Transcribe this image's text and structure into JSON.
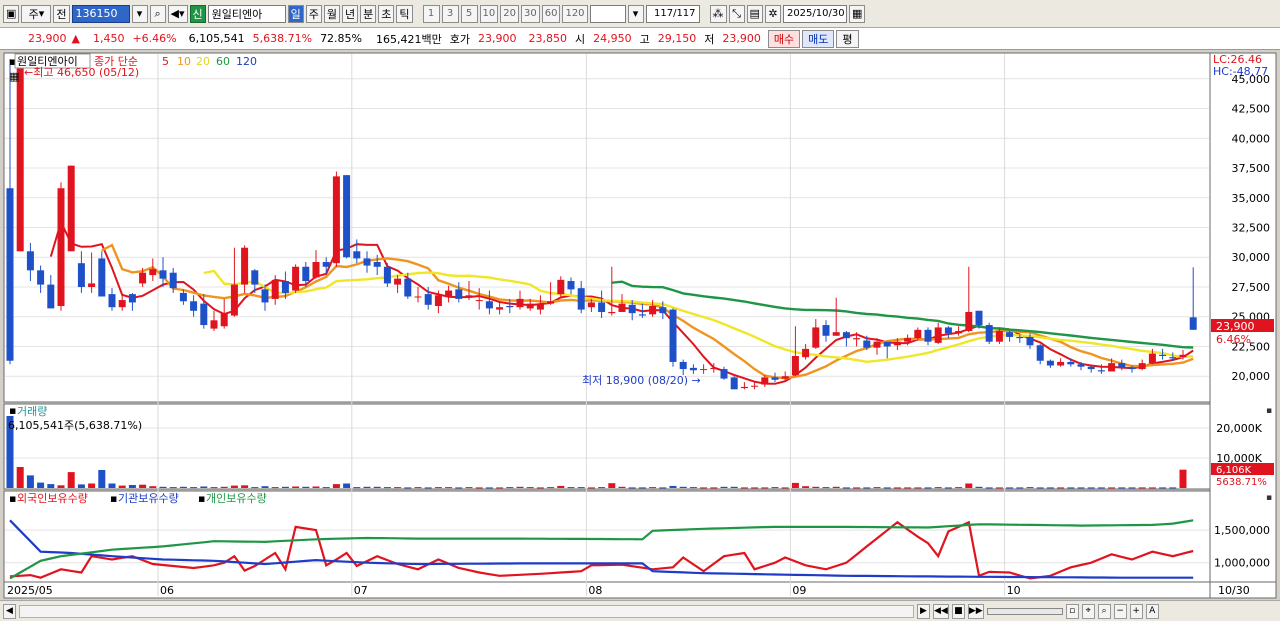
{
  "toolbar": {
    "period_week": "주",
    "prev_label": "전",
    "code": "136150",
    "market_badge": "신",
    "stock_name": "원일티엔아",
    "periods": [
      "일",
      "주",
      "월",
      "년",
      "분",
      "초",
      "틱"
    ],
    "active_period": "일",
    "intervals": [
      "1",
      "3",
      "5",
      "10",
      "20",
      "30",
      "60",
      "120"
    ],
    "counter": "117",
    "counter_total": "/117",
    "date": "2025/10/30"
  },
  "quote": {
    "price": "23,900",
    "change_arrow": "▲",
    "change": "1,450",
    "change_pct": "+6.46%",
    "volume": "6,105,541",
    "volume_pct": "5,638.71%",
    "turnover": "72.85%",
    "amount": "165,421백만",
    "hoga_label": "호가",
    "ask": "23,900",
    "bid": "23,850",
    "open_label": "시",
    "open": "24,950",
    "high_label": "고",
    "high": "29,150",
    "low_label": "저",
    "low": "23,900",
    "buy_label": "매수",
    "sell_label": "매도",
    "avg_label": "평"
  },
  "price_panel": {
    "name": "원일티엔아이",
    "legend_title": "종가 단순",
    "ma_labels": [
      "5",
      "10",
      "20",
      "60",
      "120"
    ],
    "ma_colors": [
      "#e0141e",
      "#f09420",
      "#f0e628",
      "#1e9646",
      "#1e3cc8"
    ],
    "max_label": "최고 46,650 (05/12)",
    "min_label": "최저 18,900 (08/20)",
    "lc_label": "LC:26.46",
    "hc_label": "HC:-48.77",
    "current_tag": "23,900",
    "current_pct_tag": "6.46%"
  },
  "volume_panel": {
    "title": "거래량",
    "info": "6,105,541주(5,638.71%)",
    "current_tag": "6,106K",
    "current_pct_tag": "5638.71%"
  },
  "holdings_panel": {
    "series_labels": [
      "외국인보유수량",
      "기관보유수량",
      "개인보유수량"
    ],
    "series_colors": [
      "#e0141e",
      "#1e3cc8",
      "#1e9646"
    ]
  },
  "chart_data": {
    "type": "candlestick",
    "price_axis": {
      "ticks": [
        20000,
        22500,
        25000,
        27500,
        30000,
        32500,
        35000,
        37500,
        40000,
        42500,
        45000
      ],
      "labels": [
        "20,000",
        "22,500",
        "25,000",
        "27,500",
        "30,000",
        "32,500",
        "35,000",
        "37,500",
        "40,000",
        "42,500",
        "45,000"
      ],
      "range": [
        18000,
        47000
      ]
    },
    "volume_axis": {
      "labels": [
        "10,000K",
        "20,000K"
      ],
      "ticks": [
        10000,
        20000
      ],
      "range": [
        0,
        27000
      ]
    },
    "holdings_axis": {
      "labels": [
        "1,000,000",
        "1,500,000"
      ],
      "ticks": [
        1000000,
        1500000
      ],
      "range": [
        720000,
        1870000
      ]
    },
    "date_labels": [
      "2025/05",
      "06",
      "07",
      "08",
      "09",
      "10",
      "10/30"
    ],
    "date_label_index": [
      0,
      15,
      34,
      57,
      77,
      98,
      116
    ],
    "candles": [
      [
        35800,
        21300,
        46650,
        21000
      ],
      [
        30500,
        46650,
        46650,
        30500
      ],
      [
        30500,
        28900,
        31200,
        28000
      ],
      [
        28900,
        27700,
        29300,
        27000
      ],
      [
        27700,
        25700,
        28500,
        25700
      ],
      [
        25900,
        35800,
        36300,
        25500
      ],
      [
        30500,
        37700,
        37700,
        30500
      ],
      [
        29500,
        27500,
        30500,
        27000
      ],
      [
        27500,
        27800,
        30400,
        27000
      ],
      [
        29900,
        26700,
        30500,
        26700
      ],
      [
        26900,
        25800,
        27400,
        25500
      ],
      [
        25800,
        26400,
        26900,
        25500
      ],
      [
        26900,
        26200,
        27000,
        25500
      ],
      [
        27800,
        28700,
        29100,
        27500
      ],
      [
        28500,
        29000,
        29900,
        28000
      ],
      [
        28900,
        28200,
        30000,
        27500
      ],
      [
        28700,
        27400,
        29100,
        27000
      ],
      [
        27000,
        26300,
        27300,
        26000
      ],
      [
        26300,
        25500,
        26800,
        25000
      ],
      [
        26100,
        24300,
        26900,
        24000
      ],
      [
        24000,
        24700,
        25500,
        23800
      ],
      [
        24200,
        25300,
        26500,
        24000
      ],
      [
        25100,
        27700,
        30800,
        25000
      ],
      [
        27700,
        30800,
        31000,
        27000
      ],
      [
        28900,
        27700,
        29000,
        27000
      ],
      [
        27300,
        26200,
        27700,
        25500
      ],
      [
        26500,
        28100,
        28500,
        26000
      ],
      [
        28000,
        27000,
        28800,
        26500
      ],
      [
        27200,
        29200,
        29400,
        27000
      ],
      [
        29200,
        28000,
        29600,
        27500
      ],
      [
        28300,
        29600,
        30600,
        28200
      ],
      [
        29600,
        29200,
        30000,
        28600
      ],
      [
        29500,
        36800,
        37200,
        29200
      ],
      [
        36900,
        30000,
        36900,
        29900
      ],
      [
        30500,
        29900,
        31500,
        29500
      ],
      [
        29900,
        29300,
        30500,
        28700
      ],
      [
        29600,
        29200,
        30200,
        28500
      ],
      [
        29200,
        27800,
        29500,
        27500
      ],
      [
        27700,
        28200,
        28500,
        27000
      ],
      [
        28200,
        26700,
        28700,
        26500
      ],
      [
        26700,
        26700,
        27500,
        26200
      ],
      [
        26900,
        26000,
        27500,
        25600
      ],
      [
        25900,
        26800,
        27200,
        25300
      ],
      [
        26700,
        27200,
        27600,
        26200
      ],
      [
        27300,
        26500,
        27900,
        26200
      ],
      [
        26600,
        26800,
        28000,
        26400
      ],
      [
        26400,
        26400,
        27400,
        25600
      ],
      [
        26300,
        25700,
        27200,
        25200
      ],
      [
        25600,
        25800,
        26300,
        25200
      ],
      [
        25900,
        25800,
        26500,
        25300
      ],
      [
        25800,
        26500,
        27200,
        25600
      ],
      [
        25700,
        26100,
        26500,
        25500
      ],
      [
        25600,
        26100,
        26800,
        25200
      ],
      [
        26100,
        26300,
        27900,
        26000
      ],
      [
        26900,
        28100,
        28400,
        26600
      ],
      [
        28000,
        27300,
        28300,
        26900
      ],
      [
        27400,
        25600,
        28000,
        25300
      ],
      [
        25800,
        26200,
        26500,
        25400
      ],
      [
        26200,
        25400,
        27200,
        24900
      ],
      [
        25300,
        25400,
        29200,
        25100
      ],
      [
        25400,
        26100,
        26900,
        25400
      ],
      [
        26000,
        25300,
        26400,
        24700
      ],
      [
        25200,
        25100,
        26100,
        24900
      ],
      [
        25200,
        25900,
        26400,
        25000
      ],
      [
        25800,
        25300,
        26300,
        24800
      ],
      [
        25600,
        21200,
        25700,
        20800
      ],
      [
        21200,
        20600,
        21400,
        20100
      ],
      [
        20700,
        20500,
        21000,
        20200
      ],
      [
        20600,
        20600,
        21000,
        20200
      ],
      [
        20600,
        20700,
        21100,
        20300
      ],
      [
        20600,
        19800,
        20800,
        19700
      ],
      [
        19900,
        18900,
        20000,
        18900
      ],
      [
        19000,
        19100,
        19500,
        18900
      ],
      [
        19200,
        19200,
        19600,
        18900
      ],
      [
        19300,
        19900,
        20100,
        19100
      ],
      [
        19900,
        19700,
        20300,
        19500
      ],
      [
        19800,
        20000,
        20400,
        19600
      ],
      [
        20100,
        21700,
        24200,
        20000
      ],
      [
        21600,
        22300,
        22700,
        21400
      ],
      [
        22400,
        24100,
        24800,
        22300
      ],
      [
        24300,
        23400,
        24700,
        22900
      ],
      [
        23400,
        23700,
        26600,
        23400
      ],
      [
        23700,
        23200,
        23800,
        22500
      ],
      [
        23100,
        23200,
        23700,
        22500
      ],
      [
        23000,
        22400,
        23400,
        22200
      ],
      [
        22400,
        22900,
        23200,
        21800
      ],
      [
        22900,
        22500,
        22800,
        21500
      ],
      [
        22600,
        22900,
        23200,
        22200
      ],
      [
        22900,
        23200,
        23500,
        22600
      ],
      [
        23200,
        23900,
        24100,
        23000
      ],
      [
        23900,
        22900,
        24100,
        22600
      ],
      [
        22800,
        24100,
        24500,
        22700
      ],
      [
        24100,
        23600,
        24200,
        23200
      ],
      [
        23600,
        23800,
        24200,
        23400
      ],
      [
        23800,
        25400,
        29200,
        23700
      ],
      [
        25500,
        24300,
        25500,
        24000
      ],
      [
        24300,
        22900,
        24500,
        22700
      ],
      [
        22900,
        23800,
        24000,
        22700
      ],
      [
        23700,
        23300,
        23800,
        22900
      ],
      [
        23300,
        23200,
        23500,
        22800
      ],
      [
        23300,
        22600,
        23600,
        22300
      ],
      [
        22600,
        21300,
        22700,
        21000
      ],
      [
        21300,
        20900,
        21400,
        20700
      ],
      [
        20900,
        21200,
        21500,
        20800
      ],
      [
        21200,
        21000,
        21500,
        20800
      ],
      [
        21000,
        20800,
        21200,
        20500
      ],
      [
        20800,
        20600,
        20900,
        20300
      ],
      [
        20500,
        20400,
        21000,
        20200
      ],
      [
        20400,
        21100,
        21500,
        20400
      ],
      [
        21100,
        20700,
        21400,
        20500
      ],
      [
        20700,
        20600,
        20900,
        20300
      ],
      [
        20600,
        21100,
        21400,
        20500
      ],
      [
        21100,
        21900,
        22300,
        21000
      ],
      [
        21800,
        21700,
        22300,
        21400
      ],
      [
        21600,
        21500,
        22000,
        21300
      ],
      [
        21600,
        21800,
        22200,
        21400
      ],
      [
        24950,
        23900,
        29150,
        23900
      ]
    ],
    "volume_values": [
      24000,
      7000,
      4200,
      1800,
      1300,
      900,
      5300,
      1200,
      1500,
      6000,
      1500,
      800,
      1000,
      1100,
      600,
      400,
      300,
      400,
      300,
      500,
      300,
      400,
      800,
      900,
      300,
      600,
      300,
      400,
      500,
      400,
      500,
      300,
      1300,
      1500,
      300,
      400,
      400,
      300,
      300,
      200,
      300,
      200,
      300,
      300,
      200,
      300,
      200,
      200,
      200,
      300,
      400,
      300,
      200,
      300,
      700,
      300,
      300,
      200,
      300,
      1600,
      400,
      200,
      200,
      300,
      200,
      700,
      400,
      300,
      200,
      200,
      400,
      400,
      200,
      200,
      200,
      300,
      200,
      1700,
      600,
      400,
      300,
      400,
      200,
      200,
      200,
      300,
      200,
      200,
      200,
      200,
      200,
      300,
      200,
      300,
      1500,
      400,
      200,
      200,
      200,
      200,
      300,
      200,
      200,
      200,
      200,
      200,
      200,
      200,
      200,
      200,
      200,
      200,
      200,
      200,
      200,
      6106
    ],
    "holdings_series": [
      {
        "name": "외국인보유수량",
        "color": "#e0141e"
      },
      {
        "name": "기관보유수량",
        "color": "#1e3cc8"
      },
      {
        "name": "개인보유수량",
        "color": "#1e9646"
      }
    ]
  }
}
